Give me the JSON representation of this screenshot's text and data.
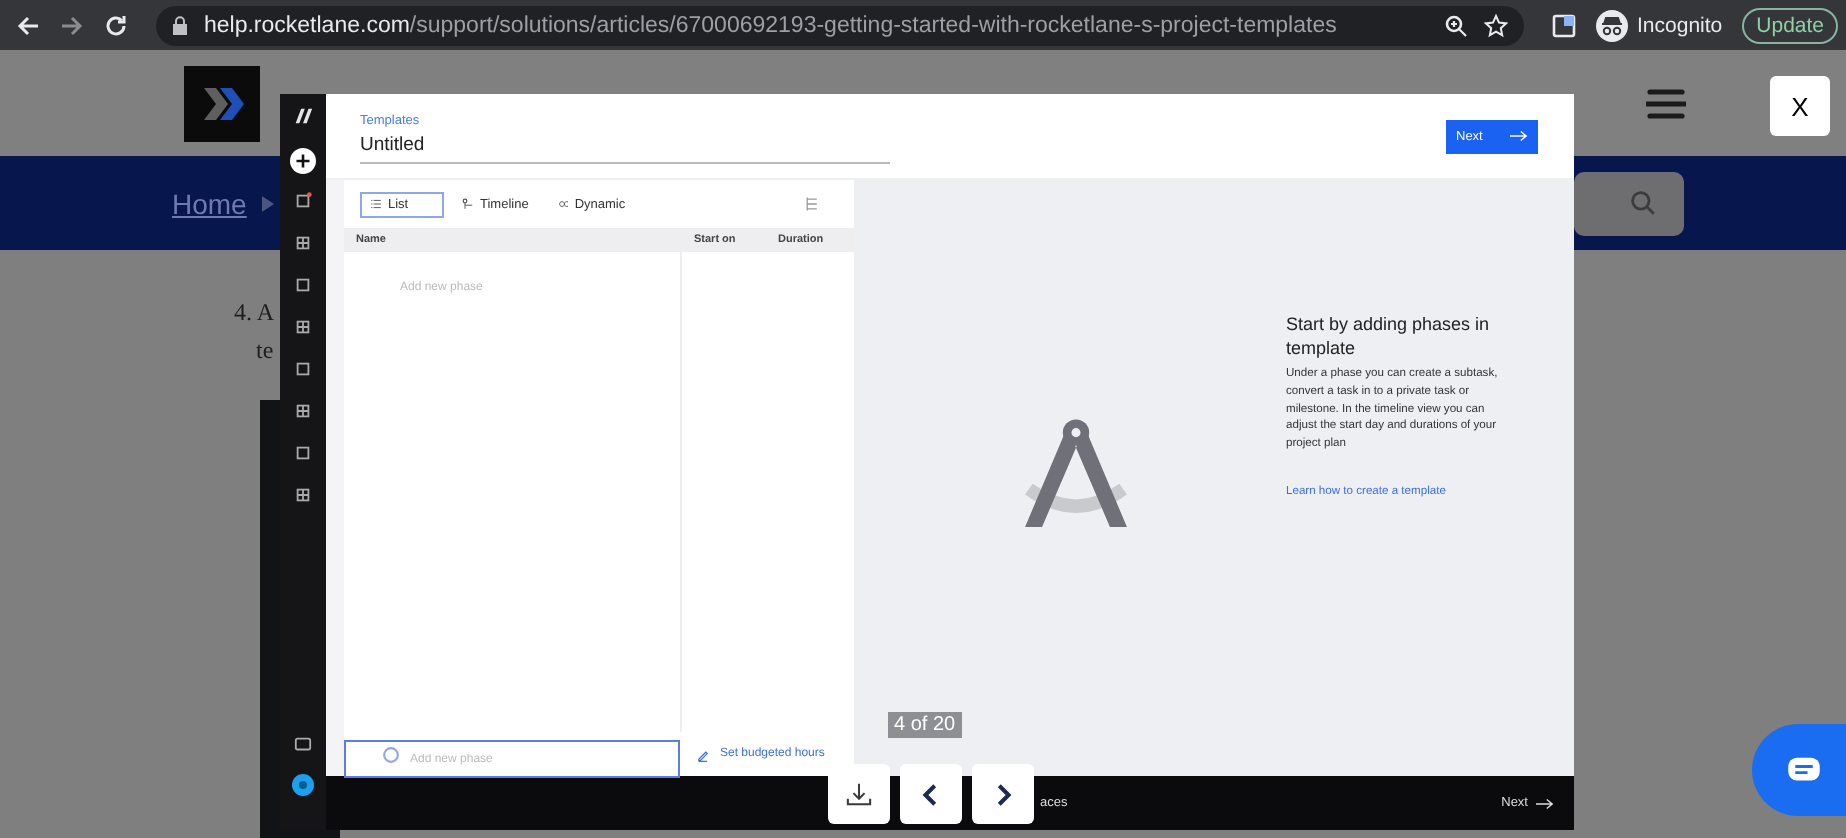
{
  "browser": {
    "url_host": "help.rocketlane.com",
    "url_path": "/support/solutions/articles/67000692193-getting-started-with-rocketlane-s-project-templates",
    "profile_label": "Incognito",
    "update_button": "Update"
  },
  "page": {
    "breadcrumb": "Home",
    "step_text": "4. A",
    "step_text_2": "te"
  },
  "lightbox": {
    "close_button": "X",
    "counter": "4 of 20",
    "app": {
      "section_label": "Templates",
      "title": "Untitled",
      "next_button": "Next",
      "view_tabs": [
        {
          "label": "List",
          "selected": true
        },
        {
          "label": "Timeline",
          "selected": false
        },
        {
          "label": "Dynamic",
          "selected": false
        }
      ],
      "columns": [
        "Name",
        "Start on",
        "Duration"
      ],
      "add_phase_row": "Add new phase",
      "add_phase_placeholder": "Add new phase",
      "budget_link": "Set budgeted hours",
      "empty_state": {
        "heading": "Start by adding phases in template",
        "body": "Under a phase you can create a subtask, convert a task in to a private task or milestone. In the timeline view you can adjust the start day and durations of your project plan",
        "link": "Learn how to create a template"
      },
      "footer_left": "aces",
      "footer_next": "Next"
    }
  }
}
